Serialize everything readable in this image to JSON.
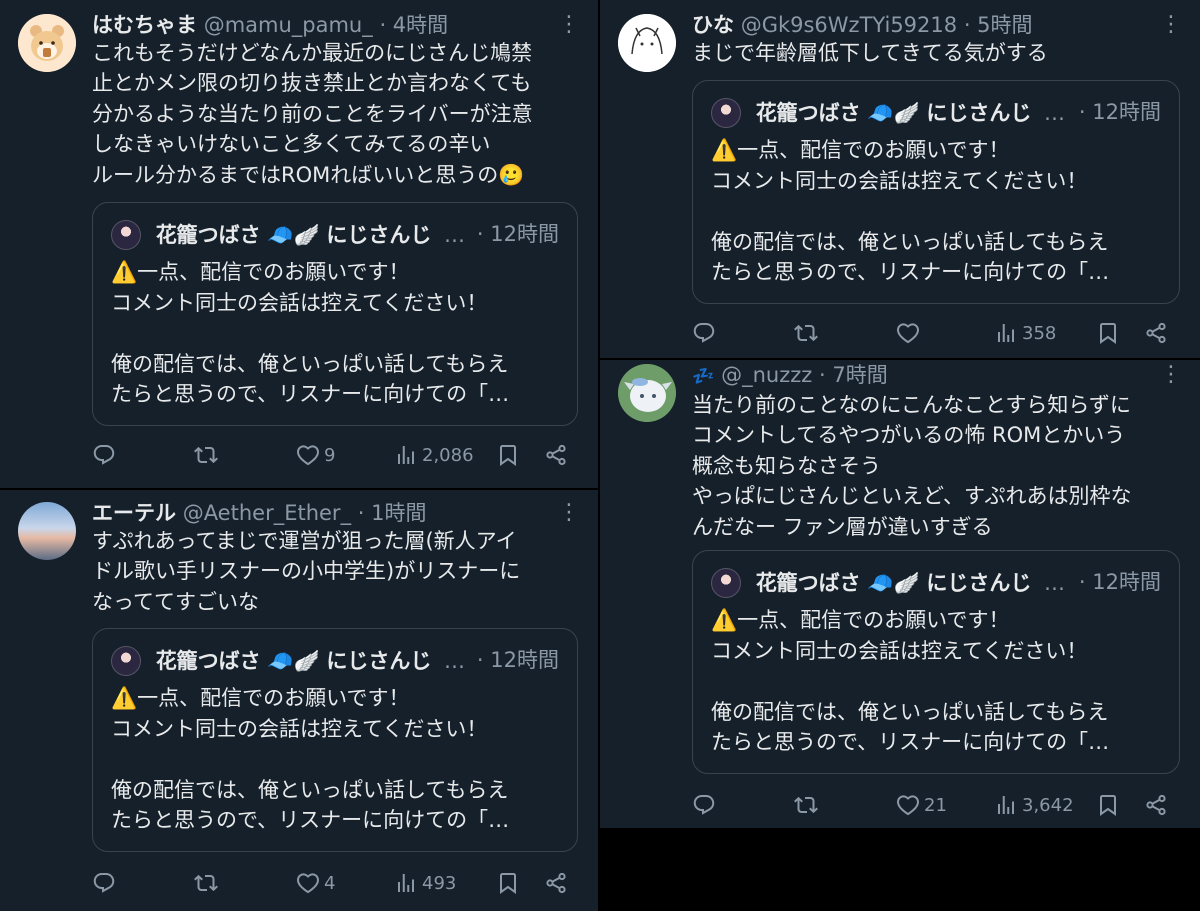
{
  "colors": {
    "background": "#15202b",
    "text": "#e7e9ea",
    "muted": "#8b98a5",
    "border": "#38444d"
  },
  "quoted_tweet": {
    "name": "花籠つばさ",
    "emojis": "🧢🪽",
    "suffix": "にじさんじ",
    "truncation": "…",
    "time": "· 12時間",
    "body": "⚠️一点、配信でのお願いです！\nコメント同士の会話は控えてください！\n\n俺の配信では、俺といっぱい話してもらえ\nたらと思うので、リスナーに向けての「…"
  },
  "tweets": [
    {
      "name": "はむちゃま",
      "handle": "@mamu_pamu_",
      "time": "· 4時間",
      "text": "これもそうだけどなんか最近のにじさんじ鳩禁\n止とかメン限の切り抜き禁止とか言わなくても\n分かるような当たり前のことをライバーが注意\nしなきゃいけないこと多くてみてるの辛い\nルール分かるまではROMればいいと思うの🥲",
      "likes": "9",
      "views": "2,086"
    },
    {
      "name": "エーテル",
      "handle": "@Aether_Ether_",
      "time": "· 1時間",
      "text": "すぷれあってまじで運営が狙った層(新人アイ\nドル歌い手リスナーの小中学生)がリスナーに\nなっててすごいな",
      "likes": "4",
      "views": "493"
    },
    {
      "name": "ひな",
      "handle": "@Gk9s6WzTYi59218",
      "time": "· 5時間",
      "text": "まじで年齢層低下してきてる気がする",
      "likes": "",
      "views": "358"
    },
    {
      "name": "💤",
      "handle": "@_nuzzz",
      "time": "· 7時間",
      "text": "当たり前のことなのにこんなことすら知らずに\nコメントしてるやつがいるの怖 ROMとかいう\n概念も知らなさそう\nやっぱにじさんじといえど、すぷれあは別枠な\nんだなー ファン層が違いすぎる",
      "likes": "21",
      "views": "3,642"
    }
  ],
  "ui": {
    "more": "⋮"
  }
}
